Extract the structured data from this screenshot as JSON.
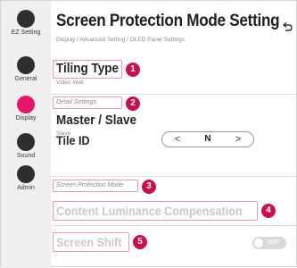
{
  "sidebar": {
    "items": [
      {
        "label": "EZ Setting"
      },
      {
        "label": "General"
      },
      {
        "label": "Display"
      },
      {
        "label": "Sound"
      },
      {
        "label": "Admin"
      }
    ],
    "active_color": "#e5166b"
  },
  "header": {
    "title": "Screen Protection Mode Setting",
    "breadcrumb": "Display / Advanced Setting / OLED Panel Settings",
    "back_icon": "back-arrow-icon"
  },
  "tiling": {
    "title": "Tiling Type",
    "value": "Video Wall"
  },
  "detail_section": {
    "label": "Detail Settings"
  },
  "master_slave": {
    "title": "Master / Slave",
    "value": "Slave"
  },
  "tile_id": {
    "label": "Tile ID",
    "value": "N",
    "prev": "<",
    "next": ">"
  },
  "protection_section": {
    "label": "Screen Protection Mode"
  },
  "clc": {
    "label": "Content Luminance Compensation"
  },
  "screen_shift": {
    "label": "Screen Shift",
    "state": "OFF"
  },
  "callouts": [
    "1",
    "2",
    "3",
    "4",
    "5"
  ],
  "colors": {
    "callout": "#c8104a",
    "highlight": "#e79ab3"
  }
}
